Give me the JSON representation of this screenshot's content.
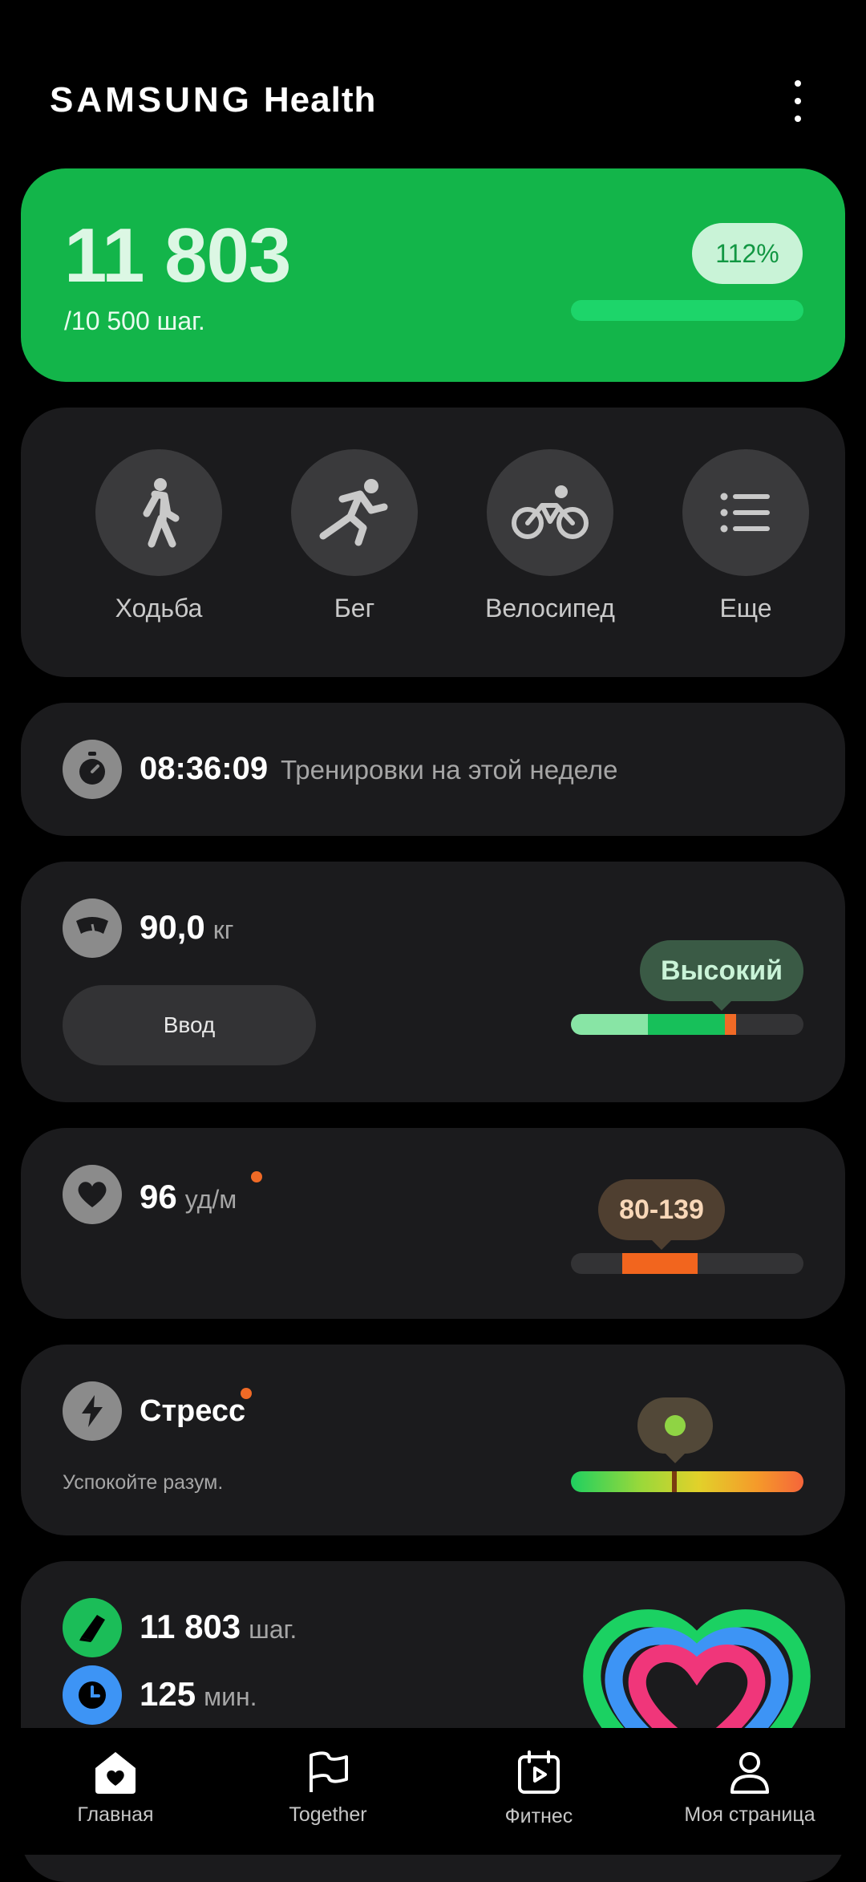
{
  "header": {
    "brand": "SAMSUNG",
    "product": "Health"
  },
  "steps": {
    "value": "11 803",
    "goal": "/10 500 шаг.",
    "percent": "112%",
    "progress_fraction": 1.12
  },
  "activities": [
    {
      "label": "Ходьба",
      "icon": "walking-icon"
    },
    {
      "label": "Бег",
      "icon": "running-icon"
    },
    {
      "label": "Велосипед",
      "icon": "cycling-icon"
    },
    {
      "label": "Еще",
      "icon": "list-icon"
    }
  ],
  "workout": {
    "time": "08:36:09",
    "text": "Тренировки на этой неделе"
  },
  "weight": {
    "value": "90,0",
    "unit": "кг",
    "enter_label": "Ввод",
    "status": "Высокий"
  },
  "heart_rate": {
    "value": "96",
    "unit": "уд/м",
    "range": "80-139"
  },
  "stress": {
    "title": "Стресс",
    "subtitle": "Успокойте разум."
  },
  "summary": {
    "steps_value": "11 803",
    "steps_unit": "шаг.",
    "minutes_value": "125",
    "minutes_unit": "мин."
  },
  "nav": [
    {
      "label": "Главная",
      "icon": "home-heart-icon"
    },
    {
      "label": "Together",
      "icon": "flag-icon"
    },
    {
      "label": "Фитнес",
      "icon": "fitness-calendar-icon"
    },
    {
      "label": "Моя страница",
      "icon": "profile-icon"
    }
  ],
  "colors": {
    "steps_card": "#13b54a",
    "card_bg": "#1b1b1d",
    "accent_orange": "#f06a26"
  }
}
